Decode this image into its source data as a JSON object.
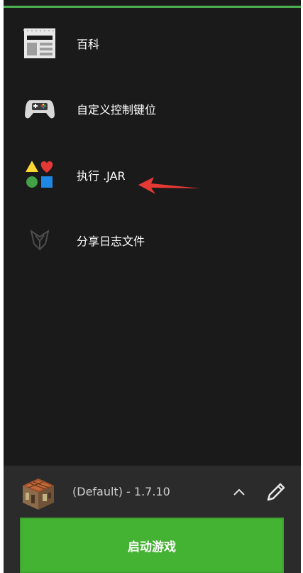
{
  "menu": {
    "items": [
      {
        "label": "百科",
        "icon": "wiki-icon"
      },
      {
        "label": "自定义控制键位",
        "icon": "gamepad-icon"
      },
      {
        "label": "执行 .JAR",
        "icon": "shapes-icon"
      },
      {
        "label": "分享日志文件",
        "icon": "share-logo-icon"
      }
    ]
  },
  "bottom": {
    "version_label": "(Default) - 1.7.10",
    "launch_label": "启动游戏"
  },
  "colors": {
    "accent": "#4caf50",
    "launch_button": "#44b233",
    "drawer_bg": "#1a1a1a",
    "bottom_bg": "#2b2b2b",
    "annotation_arrow": "#e53935"
  }
}
